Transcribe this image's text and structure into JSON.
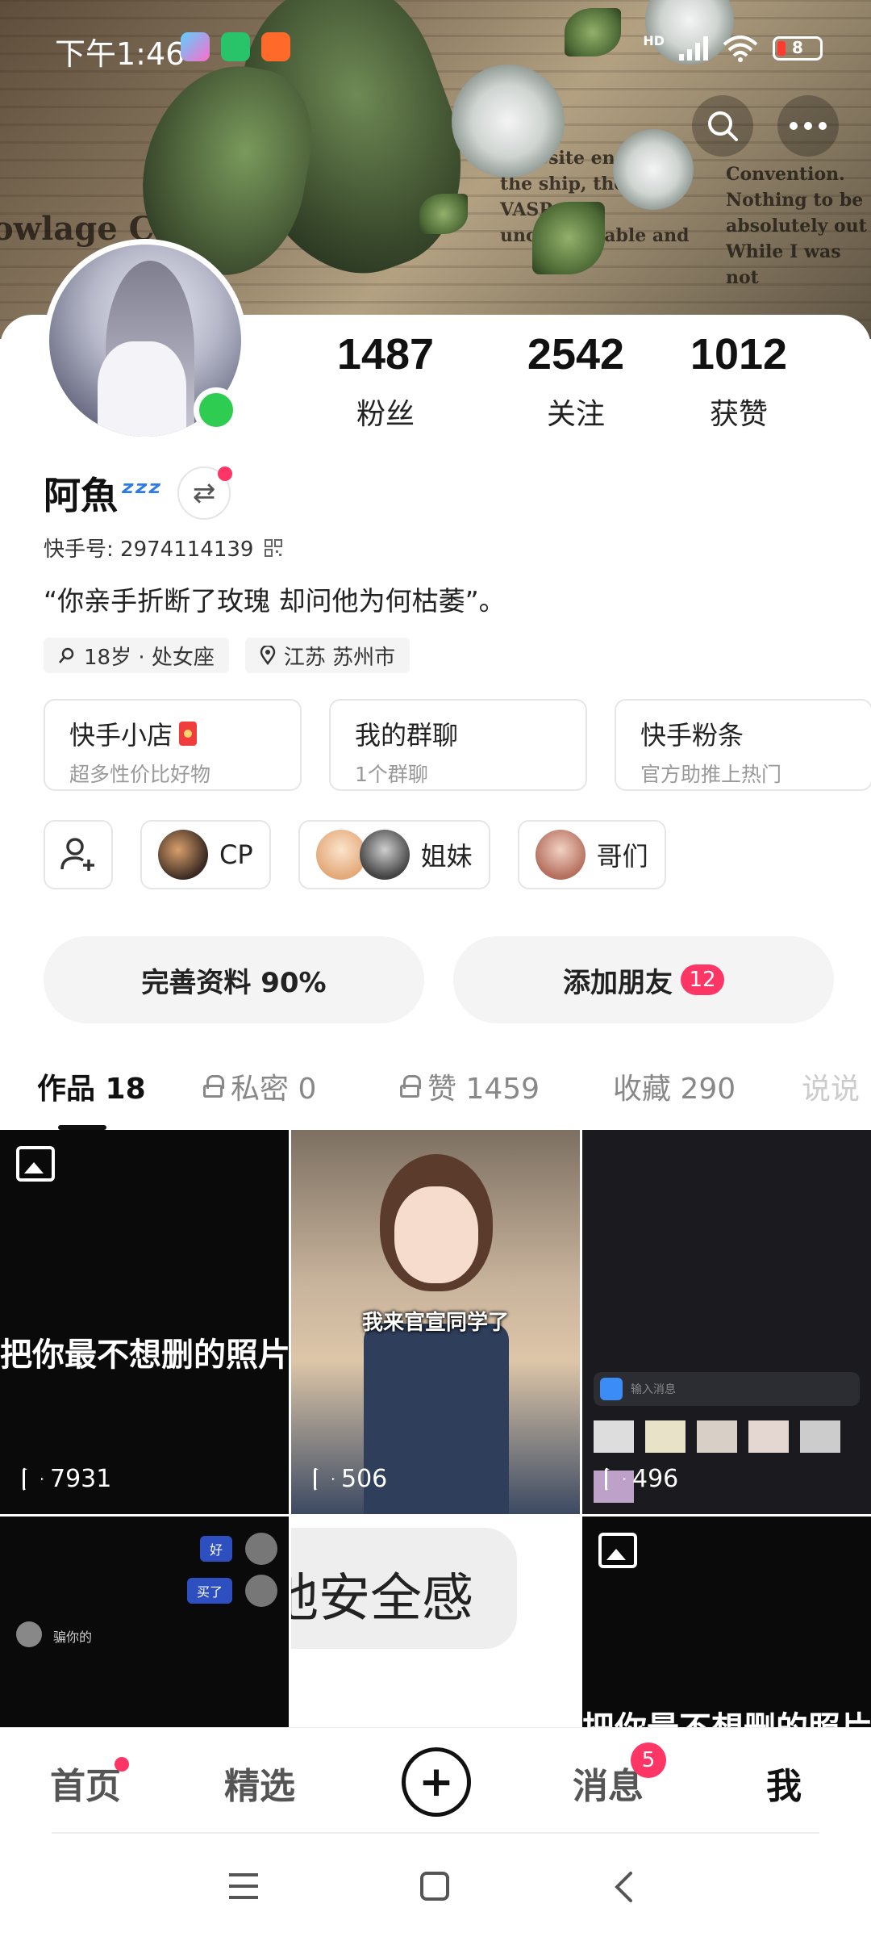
{
  "status_bar": {
    "time": "下午1:46",
    "network": "HD",
    "battery": "8"
  },
  "profile": {
    "stats": [
      {
        "value": "1487",
        "label": "粉丝"
      },
      {
        "value": "2542",
        "label": "关注"
      },
      {
        "value": "1012",
        "label": "获赞"
      }
    ],
    "name": "阿魚",
    "zzz": "ᶻᶻᶻ",
    "uid_label": "快手号: 2974114139",
    "bio": "“你亲手折断了玫瑰  却问他为何枯萎”。",
    "tags": [
      "18岁 · 处女座",
      "江苏 苏州市"
    ]
  },
  "shortcuts": [
    {
      "title": "快手小店",
      "sub": "超多性价比好物"
    },
    {
      "title": "我的群聊",
      "sub": "1个群聊"
    },
    {
      "title": "快手粉条",
      "sub": "官方助推上热门"
    }
  ],
  "groups": [
    "CP",
    "姐妹",
    "哥们"
  ],
  "actions": {
    "complete": "完善资料 90%",
    "add_friend": "添加朋友",
    "add_friend_badge": "12"
  },
  "tabs": [
    "作品 18",
    "私密 0",
    "赞 1459",
    "收藏 290",
    "说说"
  ],
  "grid": [
    {
      "caption": "把你最不想删的照片",
      "plays": "7931"
    },
    {
      "caption": "我来官宣同学了",
      "plays": "506"
    },
    {
      "caption": "输入消息",
      "plays": "496"
    },
    {
      "caption": "骗你的",
      "chat1": "好",
      "chat2": "买了"
    },
    {
      "caption": "他安全感"
    },
    {
      "caption": "把你最不想删的照片"
    }
  ],
  "nav": {
    "home": "首页",
    "featured": "精选",
    "plus": "+",
    "messages": "消息",
    "messages_badge": "5",
    "me": "我"
  },
  "colors": {
    "accent": "#fe3666",
    "online": "#2ecc50"
  }
}
